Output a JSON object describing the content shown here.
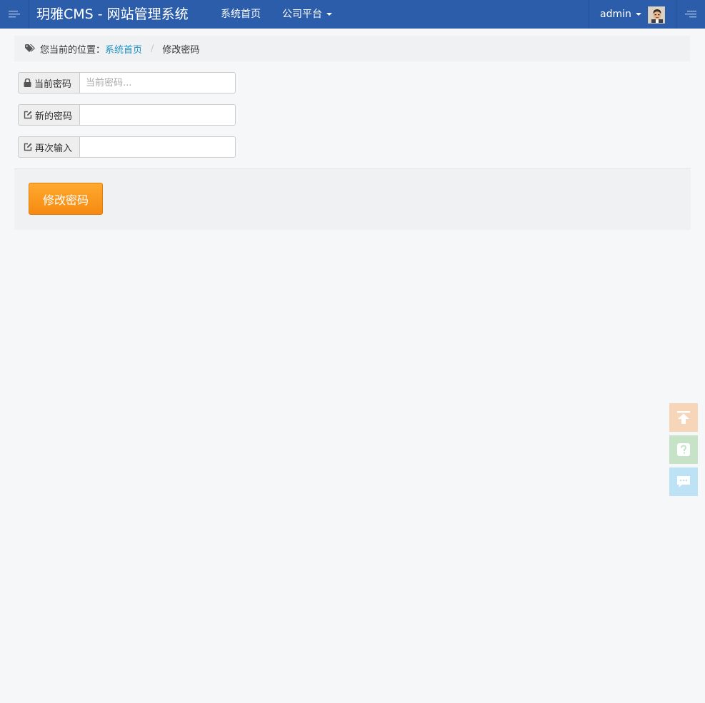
{
  "navbar": {
    "brand": "玥雅CMS - 网站管理系统",
    "links": [
      {
        "label": "系统首页"
      },
      {
        "label": "公司平台"
      }
    ],
    "user": {
      "name": "admin"
    }
  },
  "breadcrumb": {
    "prefix": "您当前的位置：",
    "home": "系统首页",
    "current": "修改密码"
  },
  "form": {
    "current_password": {
      "label": "当前密码",
      "placeholder": "当前密码...",
      "value": ""
    },
    "new_password": {
      "label": "新的密码",
      "value": ""
    },
    "confirm_password": {
      "label": "再次输入",
      "value": ""
    }
  },
  "actions": {
    "submit_label": "修改密码"
  },
  "side_tools": [
    {
      "icon": "back-to-top-icon",
      "color": "#f6d5b8"
    },
    {
      "icon": "help-icon",
      "color": "#c6e3c8"
    },
    {
      "icon": "chat-icon",
      "color": "#bde1f5"
    }
  ],
  "colors": {
    "navbar": "#2c5dab",
    "link": "#1b8fc4",
    "primary_button": "#f7941d",
    "background": "#f6f7f9"
  }
}
